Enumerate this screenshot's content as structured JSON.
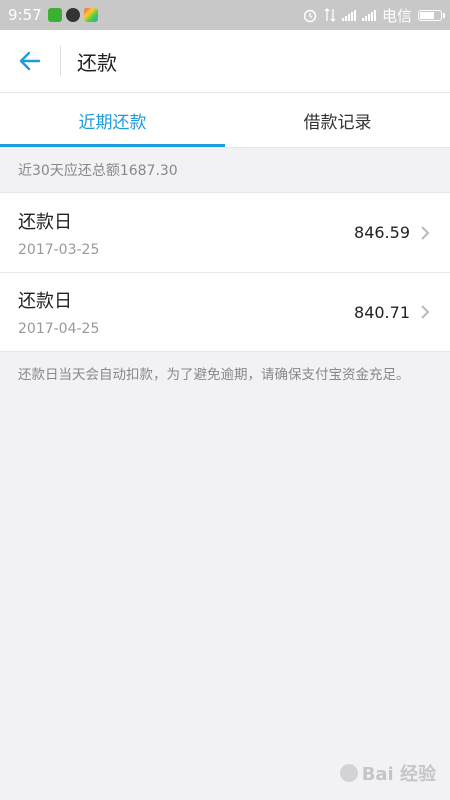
{
  "status_bar": {
    "time": "9:57",
    "carrier": "电信"
  },
  "header": {
    "title": "还款"
  },
  "tabs": [
    {
      "label": "近期还款",
      "active": true
    },
    {
      "label": "借款记录",
      "active": false
    }
  ],
  "summary": {
    "text": "近30天应还总额1687.30"
  },
  "repayments": [
    {
      "label": "还款日",
      "date": "2017-03-25",
      "amount": "846.59"
    },
    {
      "label": "还款日",
      "date": "2017-04-25",
      "amount": "840.71"
    }
  ],
  "note": {
    "text": "还款日当天会自动扣款，为了避免逾期，请确保支付宝资金充足。"
  },
  "watermark": {
    "text": "Bai 经验"
  },
  "colors": {
    "accent": "#1e9bdc",
    "background": "#f2f2f6"
  }
}
